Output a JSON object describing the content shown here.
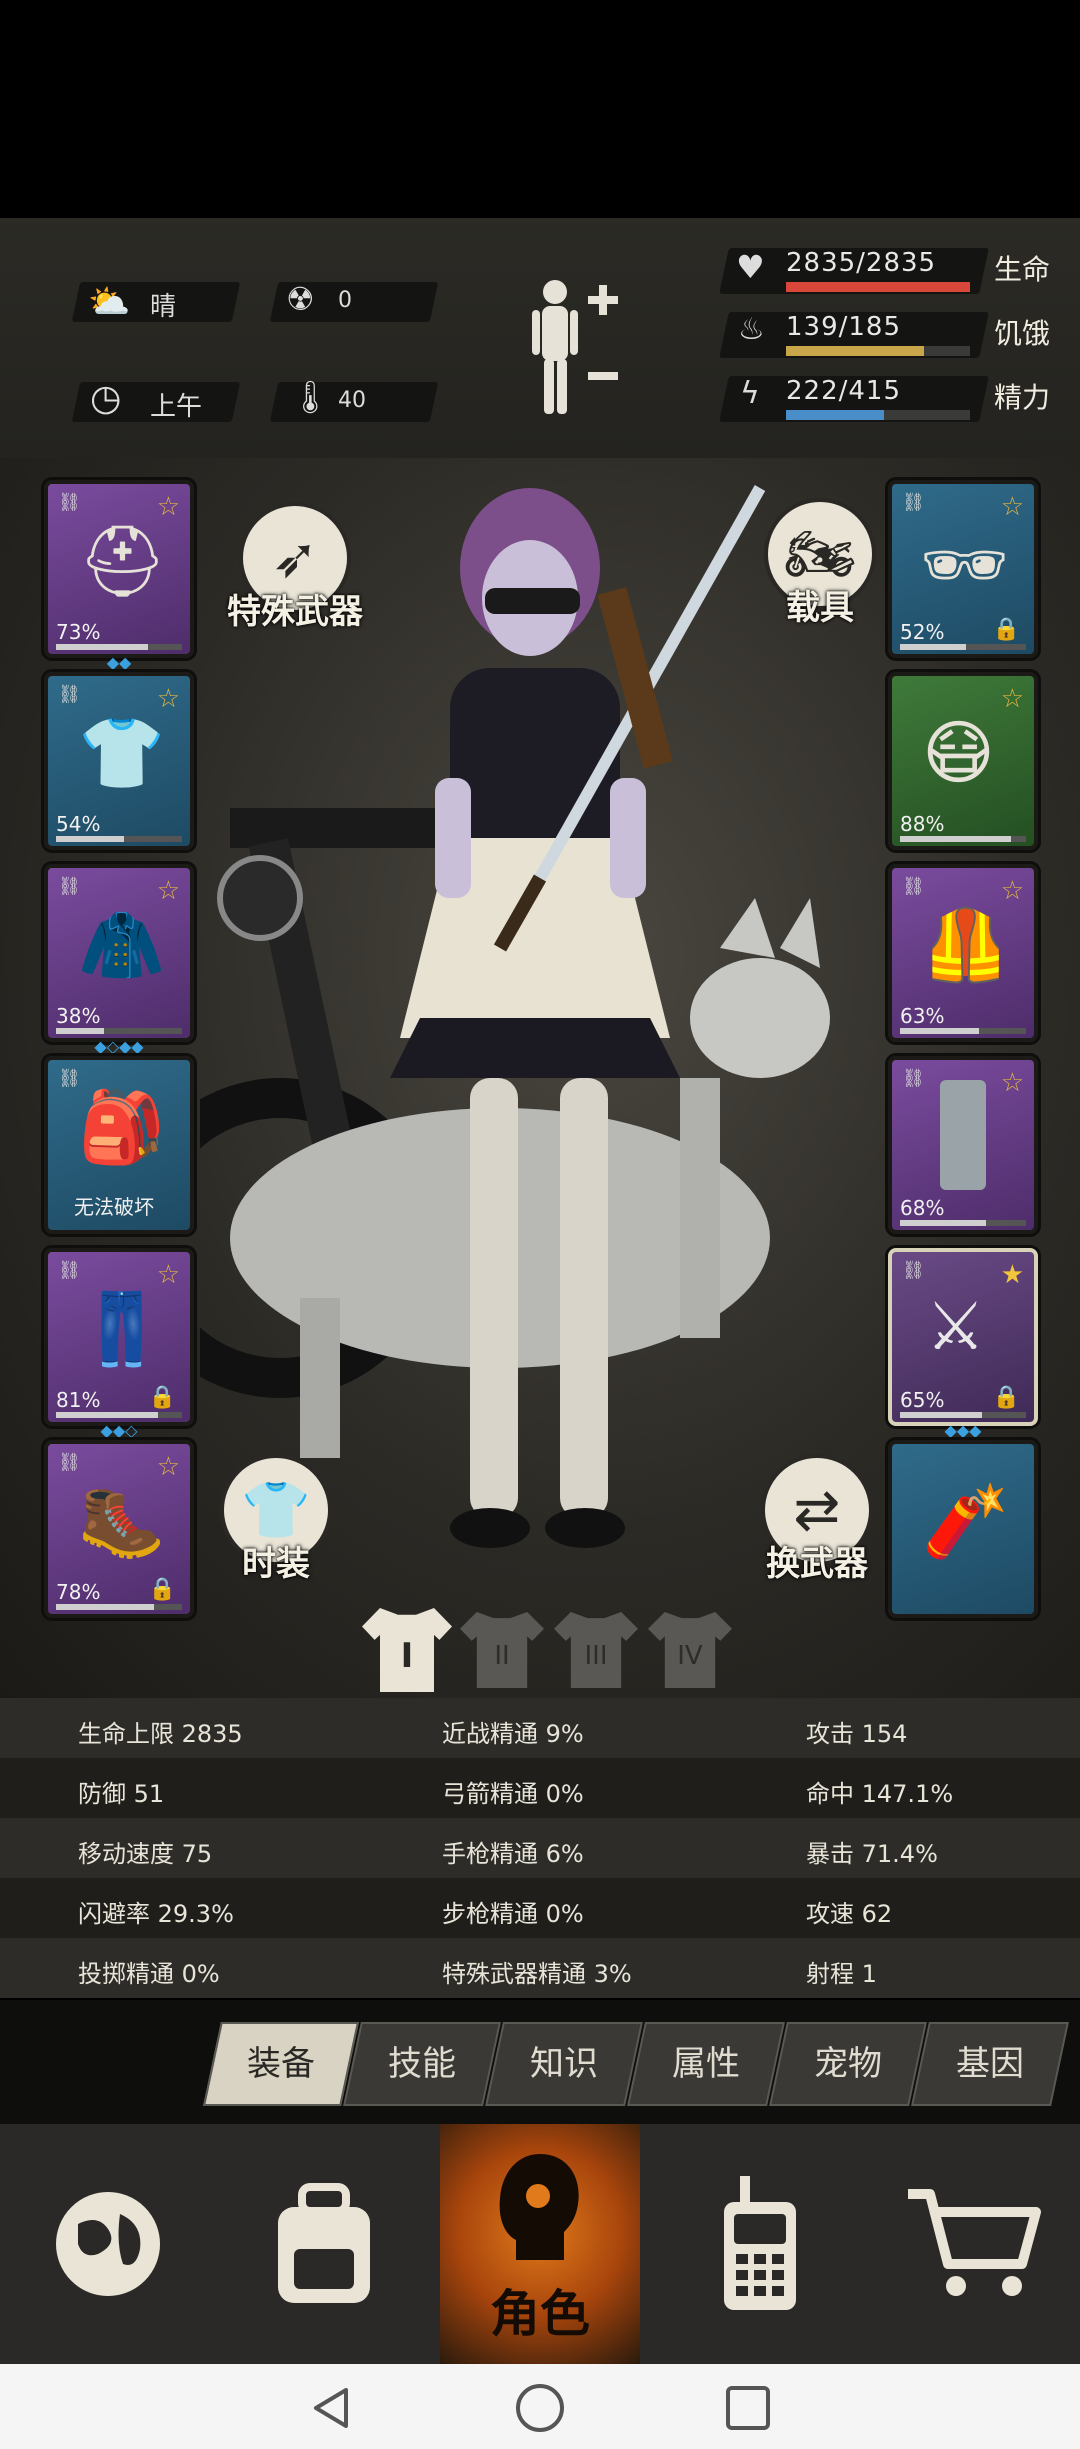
{
  "hud": {
    "weather": "晴",
    "radiation": "0",
    "time": "上午",
    "temperature": "40",
    "health": {
      "value": "2835/2835",
      "label": "生命",
      "fraction": 1.0,
      "color": "#d9473a"
    },
    "hunger": {
      "value": "139/185",
      "label": "饥饿",
      "fraction": 0.75,
      "color": "#c9a64a"
    },
    "energy": {
      "value": "222/415",
      "label": "精力",
      "fraction": 0.53,
      "color": "#4a8ec9"
    }
  },
  "left_slots": [
    {
      "name": "helmet",
      "pct": "73%",
      "durability": 0.73,
      "rarity": "purple",
      "gems": "◆◆",
      "icon": "⛑"
    },
    {
      "name": "shirt",
      "pct": "54%",
      "durability": 0.54,
      "rarity": "blue",
      "gems": "",
      "icon": "👕"
    },
    {
      "name": "jacket",
      "pct": "38%",
      "durability": 0.38,
      "rarity": "purple",
      "gems": "◆◇◆◆",
      "icon": "🧥"
    },
    {
      "name": "backpack",
      "pct": "无法破坏",
      "durability": 1.0,
      "rarity": "blue",
      "gems": "",
      "icon": "🎒"
    },
    {
      "name": "pants",
      "pct": "81%",
      "durability": 0.81,
      "rarity": "purple",
      "gems": "◆◆◇",
      "icon": "👖",
      "locked": true
    },
    {
      "name": "boots",
      "pct": "78%",
      "durability": 0.78,
      "rarity": "purple",
      "gems": "",
      "icon": "🥾",
      "locked": true
    }
  ],
  "right_slots": [
    {
      "name": "sunglasses",
      "pct": "52%",
      "durability": 0.52,
      "rarity": "blue",
      "icon": "🕶",
      "locked": true
    },
    {
      "name": "mask",
      "pct": "88%",
      "durability": 0.88,
      "rarity": "green",
      "icon": "😷"
    },
    {
      "name": "vest",
      "pct": "63%",
      "durability": 0.63,
      "rarity": "purple",
      "icon": "🦺"
    },
    {
      "name": "shield",
      "pct": "68%",
      "durability": 0.68,
      "rarity": "purple",
      "icon": "▮"
    },
    {
      "name": "katana",
      "pct": "65%",
      "durability": 0.65,
      "rarity": "gold",
      "icon": "⚔",
      "locked": true,
      "gems": "◆◆◆"
    },
    {
      "name": "explosive",
      "pct": "",
      "durability": 0,
      "rarity": "blue",
      "icon": "🧨"
    }
  ],
  "buttons": {
    "special_weapon": "特殊武器",
    "vehicle": "载具",
    "fashion": "时装",
    "swap_weapon": "换武器"
  },
  "loadouts": [
    "I",
    "II",
    "III",
    "IV"
  ],
  "stats": [
    [
      "生命上限 2835",
      "近战精通 9%",
      "攻击 154"
    ],
    [
      "防御 51",
      "弓箭精通 0%",
      "命中 147.1%"
    ],
    [
      "移动速度 75",
      "手枪精通 6%",
      "暴击 71.4%"
    ],
    [
      "闪避率 29.3%",
      "步枪精通 0%",
      "攻速 62"
    ],
    [
      "投掷精通 0%",
      "特殊武器精通 3%",
      "射程 1"
    ]
  ],
  "tabs": [
    "装备",
    "技能",
    "知识",
    "属性",
    "宠物",
    "基因"
  ],
  "nav": {
    "character_label": "角色"
  }
}
